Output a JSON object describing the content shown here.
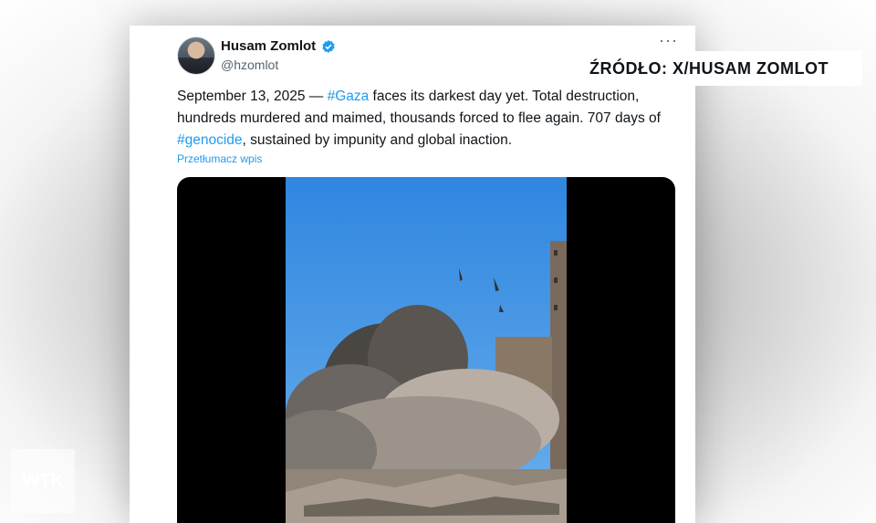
{
  "tweet": {
    "author_name": "Husam Zomlot",
    "author_handle": "@hzomlot",
    "more_label": "···",
    "text_part1": "September 13, 2025 — ",
    "hashtag1": "#Gaza",
    "text_part2": " faces its darkest day yet. Total destruction, hundreds murdered and maimed, thousands forced to flee again. 707 days of ",
    "hashtag2": "#genocide",
    "text_part3": ", sustained by impunity and global inaction.",
    "translate_label": "Przetłumacz wpis"
  },
  "overlay": {
    "source_label": "ŹRÓDŁO: X/HUSAM ZOMLOT",
    "channel_logo": "WTK"
  },
  "colors": {
    "accent": "#1d9bf0",
    "text": "#0f1419",
    "muted": "#536471"
  },
  "icons": {
    "verified": "verified-badge-icon",
    "more": "more-options-icon"
  }
}
